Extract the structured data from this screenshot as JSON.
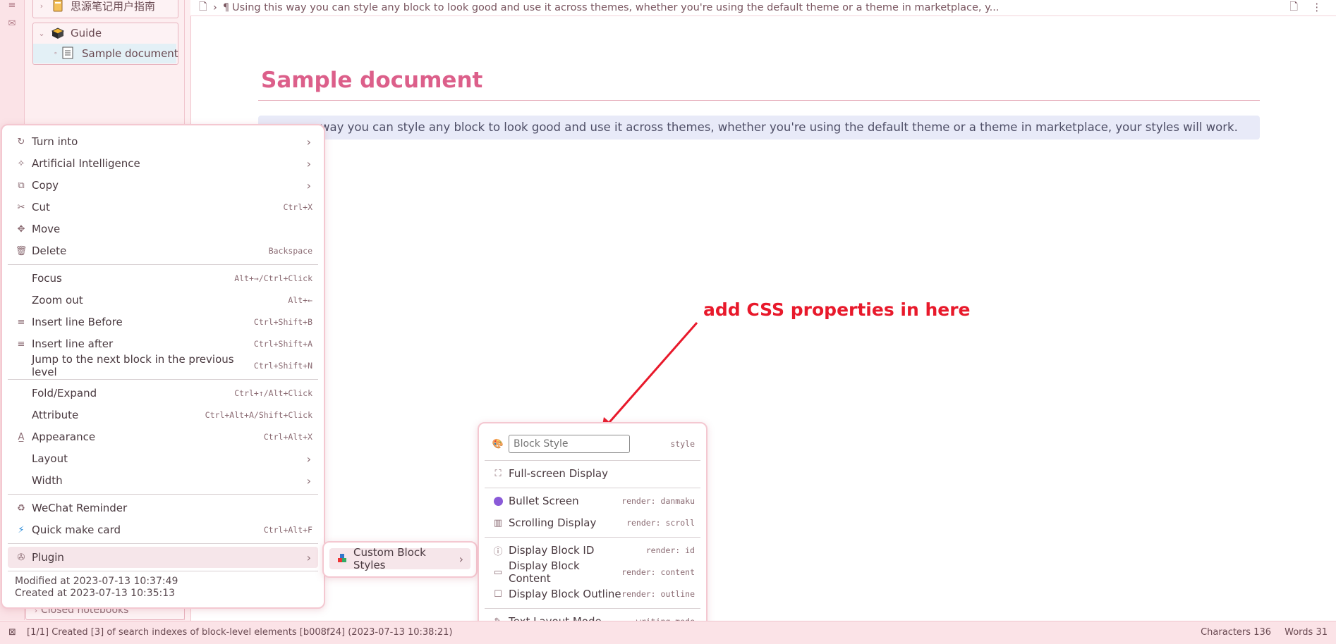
{
  "filetree": {
    "notebook1": "思源笔记用户指南",
    "notebook2": "Guide",
    "doc": "Sample document",
    "closed_notebooks": "Closed notebooks"
  },
  "breadcrumb": {
    "path_text": "Using this way you can style any block to look good and use it across themes, whether you're using the default theme or a theme in marketplace, y..."
  },
  "document": {
    "title": "Sample document",
    "paragraph": "way you can style any block to look good and use it across themes, whether you're using the default theme or a theme in marketplace, your styles will work."
  },
  "context_menu": {
    "groups": [
      [
        {
          "label": "Turn into",
          "icon": "refresh-icon",
          "shortcut": "",
          "submenu": true
        },
        {
          "label": "Artificial Intelligence",
          "icon": "sparkle-icon",
          "shortcut": "",
          "submenu": true
        },
        {
          "label": "Copy",
          "icon": "copy-icon",
          "shortcut": "",
          "submenu": true
        },
        {
          "label": "Cut",
          "icon": "scissors-icon",
          "shortcut": "Ctrl+X",
          "submenu": false
        },
        {
          "label": "Move",
          "icon": "move-icon",
          "shortcut": "",
          "submenu": false
        },
        {
          "label": "Delete",
          "icon": "trash-icon",
          "shortcut": "Backspace",
          "submenu": false
        }
      ],
      [
        {
          "label": "Focus",
          "icon": "",
          "shortcut": "Alt+→/Ctrl+Click",
          "submenu": false
        },
        {
          "label": "Zoom out",
          "icon": "",
          "shortcut": "Alt+←",
          "submenu": false
        },
        {
          "label": "Insert line Before",
          "icon": "insert-before-icon",
          "shortcut": "Ctrl+Shift+B",
          "submenu": false
        },
        {
          "label": "Insert line after",
          "icon": "insert-after-icon",
          "shortcut": "Ctrl+Shift+A",
          "submenu": false
        },
        {
          "label": "Jump to the next block in the previous level",
          "icon": "",
          "shortcut": "Ctrl+Shift+N",
          "submenu": false
        }
      ],
      [
        {
          "label": "Fold/Expand",
          "icon": "",
          "shortcut": "Ctrl+↑/Alt+Click",
          "submenu": false
        },
        {
          "label": "Attribute",
          "icon": "",
          "shortcut": "Ctrl+Alt+A/Shift+Click",
          "submenu": false
        },
        {
          "label": "Appearance",
          "icon": "text-color-icon",
          "shortcut": "Ctrl+Alt+X",
          "submenu": false
        },
        {
          "label": "Layout",
          "icon": "",
          "shortcut": "",
          "submenu": true
        },
        {
          "label": "Width",
          "icon": "",
          "shortcut": "",
          "submenu": true
        }
      ],
      [
        {
          "label": "WeChat Reminder",
          "icon": "wechat-icon",
          "shortcut": "",
          "submenu": false
        },
        {
          "label": "Quick make card",
          "icon": "lightning-icon",
          "shortcut": "Ctrl+Alt+F",
          "submenu": false
        }
      ],
      [
        {
          "label": "Plugin",
          "icon": "plugin-icon",
          "shortcut": "",
          "submenu": true,
          "active": true
        }
      ]
    ],
    "modified": "Modified at 2023-07-13 10:37:49",
    "created": "Created at 2023-07-13 10:35:13"
  },
  "plugin_submenu": {
    "item": "Custom Block Styles"
  },
  "style_submenu": {
    "input_placeholder": "Block Style",
    "input_hint": "style",
    "fullscreen": "Full-screen Display",
    "bullet_screen": "Bullet Screen",
    "bullet_screen_code": "render: danmaku",
    "scrolling_display": "Scrolling Display",
    "scrolling_display_code": "render: scroll",
    "block_id": "Display Block ID",
    "block_id_code": "render: id",
    "block_content": "Display Block Content",
    "block_content_code": "render: content",
    "block_outline": "Display Block Outline",
    "block_outline_code": "render: outline",
    "text_layout": "Text Layout Mode",
    "text_layout_code": "writing-mode"
  },
  "annotation": "add CSS properties in here",
  "statusbar": {
    "message": "[1/1] Created [3] of search indexes of block-level elements [b008f24] (2023-07-13 10:38:21)",
    "characters": "Characters 136",
    "words": "Words 31"
  },
  "colors": {
    "accent": "#dc5f8a",
    "annotation": "#e8192b",
    "menu_border": "#f4c8d1"
  }
}
